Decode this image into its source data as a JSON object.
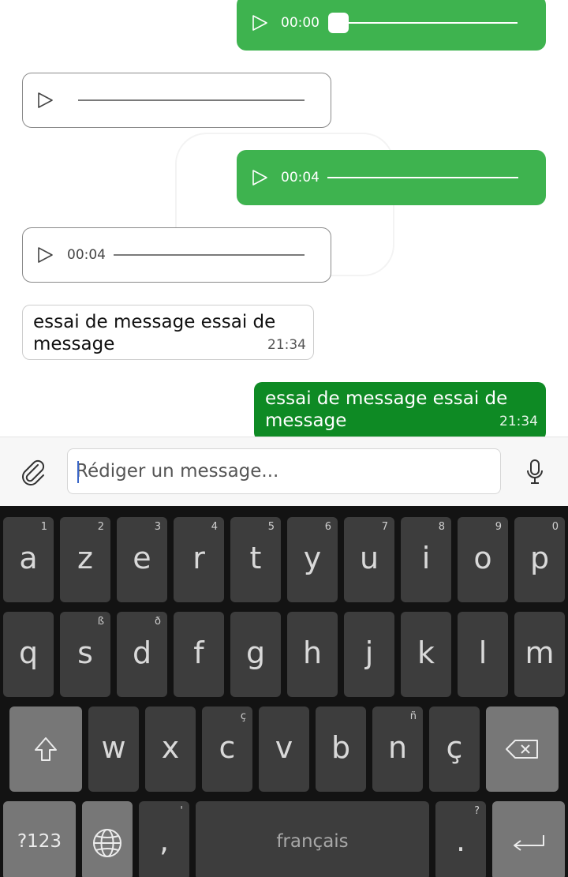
{
  "conversation": {
    "messages": [
      {
        "type": "audio",
        "direction": "outgoing",
        "duration": "00:00",
        "progress": 0
      },
      {
        "type": "audio",
        "direction": "incoming",
        "duration": ""
      },
      {
        "type": "audio",
        "direction": "outgoing",
        "duration": "00:04"
      },
      {
        "type": "audio",
        "direction": "incoming",
        "duration": "00:04"
      },
      {
        "type": "text",
        "direction": "incoming",
        "text_line1": "essai de message essai de",
        "text_line2": "message",
        "time": "21:34"
      },
      {
        "type": "text",
        "direction": "outgoing",
        "text_line1": "essai de message essai de",
        "text_line2": "message",
        "time": "21:34"
      }
    ]
  },
  "compose": {
    "placeholder": "Rédiger un message...",
    "value": "",
    "attach_icon": "paperclip-icon",
    "mic_icon": "microphone-icon"
  },
  "keyboard": {
    "row1": [
      {
        "key": "a",
        "alt": "1"
      },
      {
        "key": "z",
        "alt": "2"
      },
      {
        "key": "e",
        "alt": "3"
      },
      {
        "key": "r",
        "alt": "4"
      },
      {
        "key": "t",
        "alt": "5"
      },
      {
        "key": "y",
        "alt": "6"
      },
      {
        "key": "u",
        "alt": "7"
      },
      {
        "key": "i",
        "alt": "8"
      },
      {
        "key": "o",
        "alt": "9"
      },
      {
        "key": "p",
        "alt": "0"
      }
    ],
    "row2": [
      {
        "key": "q",
        "alt": ""
      },
      {
        "key": "s",
        "alt": "ß"
      },
      {
        "key": "d",
        "alt": "ð"
      },
      {
        "key": "f",
        "alt": ""
      },
      {
        "key": "g",
        "alt": ""
      },
      {
        "key": "h",
        "alt": ""
      },
      {
        "key": "j",
        "alt": ""
      },
      {
        "key": "k",
        "alt": ""
      },
      {
        "key": "l",
        "alt": ""
      },
      {
        "key": "m",
        "alt": ""
      }
    ],
    "row3": [
      {
        "key": "w",
        "alt": ""
      },
      {
        "key": "x",
        "alt": ""
      },
      {
        "key": "c",
        "alt": "ç"
      },
      {
        "key": "v",
        "alt": ""
      },
      {
        "key": "b",
        "alt": ""
      },
      {
        "key": "n",
        "alt": "ñ"
      },
      {
        "key": "ç",
        "alt": ""
      }
    ],
    "symbols_label": "?123",
    "comma": {
      "key": ",",
      "alt": "'"
    },
    "space_label": "français",
    "period": {
      "key": ".",
      "alt": "?"
    },
    "shift_icon": "shift-icon",
    "backspace_icon": "backspace-icon",
    "globe_icon": "globe-icon",
    "enter_icon": "enter-icon"
  },
  "colors": {
    "outgoing_audio": "#3eb34f",
    "outgoing_text": "#0e8a24",
    "keyboard_bg": "#131313",
    "key_bg": "#3d3d3d",
    "function_key_bg": "#777777"
  }
}
